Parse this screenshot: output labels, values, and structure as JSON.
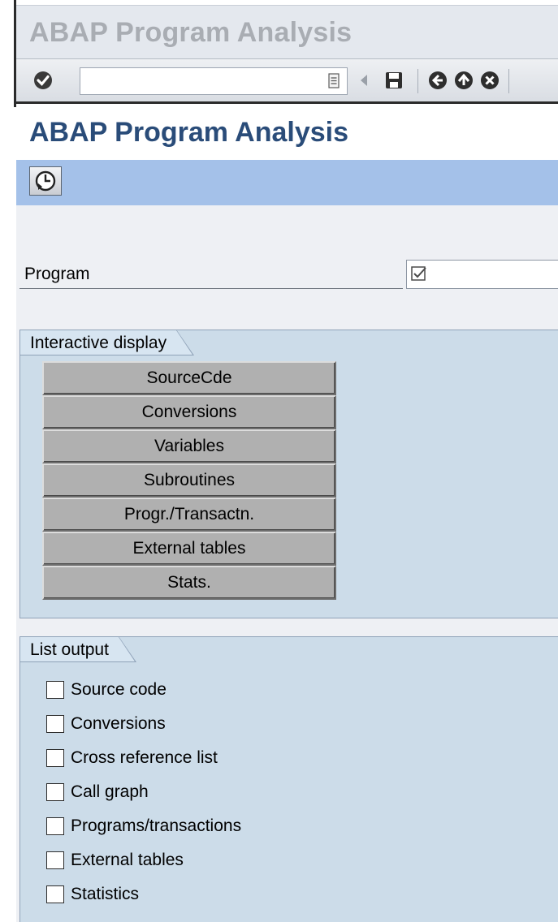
{
  "window": {
    "title": "ABAP Program Analysis"
  },
  "toolbar": {
    "command_field": {
      "value": "",
      "placeholder": ""
    },
    "icons": [
      "enter-icon",
      "command-history-icon",
      "back-triangle-icon",
      "save-icon",
      "back-icon",
      "exit-icon",
      "cancel-icon"
    ]
  },
  "page": {
    "title": "ABAP Program Analysis"
  },
  "app_toolbar": {
    "icons": [
      "execute-icon"
    ]
  },
  "program": {
    "label": "Program",
    "value": ""
  },
  "interactive_display": {
    "title": "Interactive display",
    "buttons": [
      "SourceCde",
      "Conversions",
      "Variables",
      "Subroutines",
      "Progr./Transactn.",
      "External tables",
      "Stats."
    ]
  },
  "list_output": {
    "title": "List output",
    "options": [
      {
        "label": "Source code",
        "checked": false
      },
      {
        "label": "Conversions",
        "checked": false
      },
      {
        "label": "Cross reference list",
        "checked": false
      },
      {
        "label": "Call graph",
        "checked": false
      },
      {
        "label": "Programs/transactions",
        "checked": false
      },
      {
        "label": "External tables",
        "checked": false
      },
      {
        "label": "Statistics",
        "checked": false
      }
    ]
  },
  "colors": {
    "title_text": "#2a4c79",
    "app_toolbar": "#a4c1e9",
    "group_background": "#ccdce9",
    "button_gray": "#b0b0b0"
  }
}
